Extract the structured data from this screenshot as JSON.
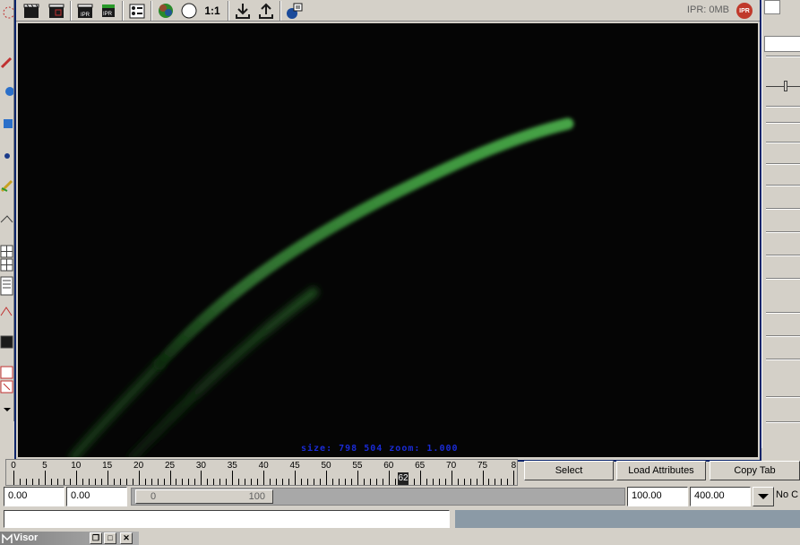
{
  "toolbar": {
    "ratio_label": "1:1",
    "ipr_memory": "IPR: 0MB",
    "ipr_badge": "IPR"
  },
  "viewport": {
    "size_readout": "size:  798  504 zoom: 1.000"
  },
  "time_slider": {
    "ticks": [
      "0",
      "5",
      "10",
      "15",
      "20",
      "25",
      "30",
      "35",
      "40",
      "45",
      "50",
      "55",
      "60",
      "65",
      "70",
      "75",
      "8"
    ],
    "current_frame": "62"
  },
  "buttons": {
    "select": "Select",
    "load_attributes": "Load Attributes",
    "copy_tab": "Copy Tab"
  },
  "range": {
    "start_time": "0.00",
    "playback_start": "0.00",
    "slider_start": "0",
    "slider_end": "100",
    "playback_end": "100.00",
    "end_time": "400.00",
    "char_label": "No C"
  },
  "visor": {
    "title": "Visor"
  },
  "colors": {
    "render_bg": "#050505",
    "stroke_green": "#3f9a3f",
    "readout_blue": "#1a2bd6",
    "window_frame": "#0a246a"
  }
}
